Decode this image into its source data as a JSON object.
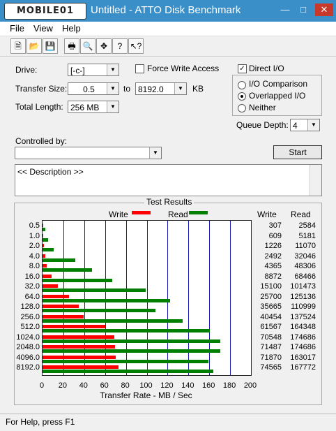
{
  "window": {
    "logo": "MOBILE01",
    "title": "Untitled - ATTO Disk Benchmark"
  },
  "menu": [
    "File",
    "View",
    "Help"
  ],
  "toolbar": [
    "new-icon",
    "open-icon",
    "save-icon",
    "print-icon",
    "print-preview-icon",
    "move-icon",
    "help-icon",
    "context-help-icon"
  ],
  "form": {
    "drive_label": "Drive:",
    "drive_value": "[-c-]",
    "force_write_label": "Force Write Access",
    "direct_io_label": "Direct I/O",
    "transfer_size_label": "Transfer Size:",
    "transfer_from": "0.5",
    "to_label": "to",
    "transfer_to": "8192.0",
    "kb_label": "KB",
    "total_length_label": "Total Length:",
    "total_length_value": "256 MB",
    "io_comparison_label": "I/O Comparison",
    "overlapped_io_label": "Overlapped I/O",
    "neither_label": "Neither",
    "queue_depth_label": "Queue Depth:",
    "queue_depth_value": "4",
    "controlled_by_label": "Controlled by:",
    "start_label": "Start",
    "description": "<< Description >>"
  },
  "results": {
    "title": "Test Results",
    "write_legend": "Write",
    "read_legend": "Read",
    "write_header": "Write",
    "read_header": "Read"
  },
  "chart_data": {
    "type": "bar",
    "title": "Test Results",
    "xlabel": "Transfer Rate - MB / Sec",
    "xlim": [
      0,
      200
    ],
    "x_ticks": [
      "0",
      "20",
      "40",
      "60",
      "80",
      "100",
      "120",
      "140",
      "160",
      "180",
      "200"
    ],
    "categories": [
      "0.5",
      "1.0",
      "2.0",
      "4.0",
      "8.0",
      "16.0",
      "32.0",
      "64.0",
      "128.0",
      "256.0",
      "512.0",
      "1024.0",
      "2048.0",
      "4096.0",
      "8192.0"
    ],
    "series": [
      {
        "name": "Write",
        "color": "#ff0000",
        "values": [
          0.3,
          0.6,
          1.2,
          2.4,
          4.3,
          8.7,
          14.7,
          25.1,
          34.8,
          39.5,
          60.1,
          68.9,
          69.8,
          70.2,
          72.8
        ],
        "labels": [
          "307",
          "609",
          "1226",
          "2492",
          "4365",
          "8872",
          "15100",
          "25700",
          "35665",
          "40454",
          "61567",
          "70548",
          "71487",
          "71870",
          "74565"
        ]
      },
      {
        "name": "Read",
        "color": "#007f00",
        "values": [
          2.5,
          5.1,
          10.8,
          31.3,
          47.2,
          66.9,
          99.1,
          122.2,
          108.4,
          134.3,
          160.5,
          170.6,
          170.6,
          159.2,
          163.8
        ],
        "labels": [
          "2584",
          "5181",
          "11070",
          "32046",
          "48306",
          "68466",
          "101473",
          "125136",
          "110999",
          "137524",
          "164348",
          "174686",
          "174686",
          "163017",
          "167772"
        ]
      }
    ]
  },
  "status": {
    "help_text": "For Help, press F1"
  }
}
